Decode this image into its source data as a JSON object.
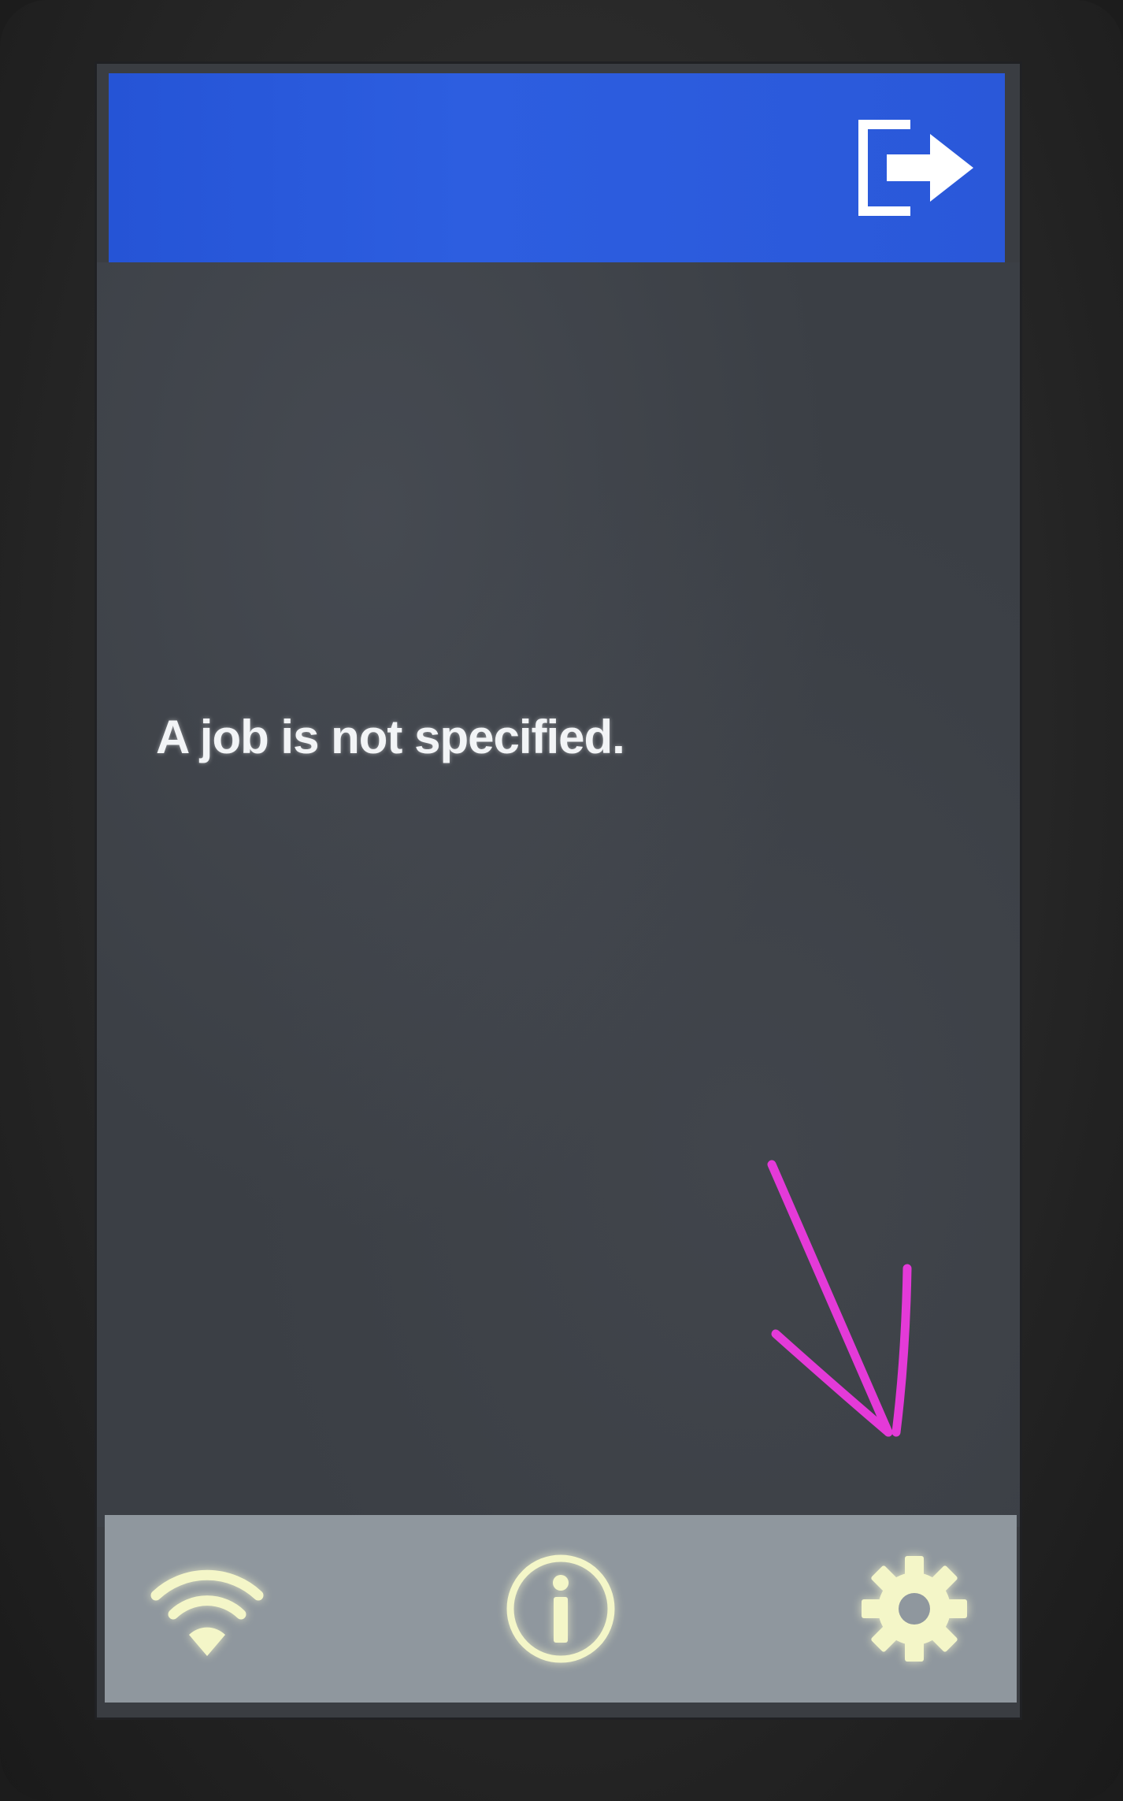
{
  "screen": {
    "message": "A job is not specified."
  },
  "header": {
    "color": "#2a58d9",
    "exit_icon": "logout-icon"
  },
  "footer": {
    "color": "#8f979e",
    "icons": [
      "wifi-icon",
      "info-icon",
      "gear-icon"
    ],
    "icon_color": "#f4f6c8"
  },
  "annotation": {
    "arrow_color": "#e43ad8"
  }
}
